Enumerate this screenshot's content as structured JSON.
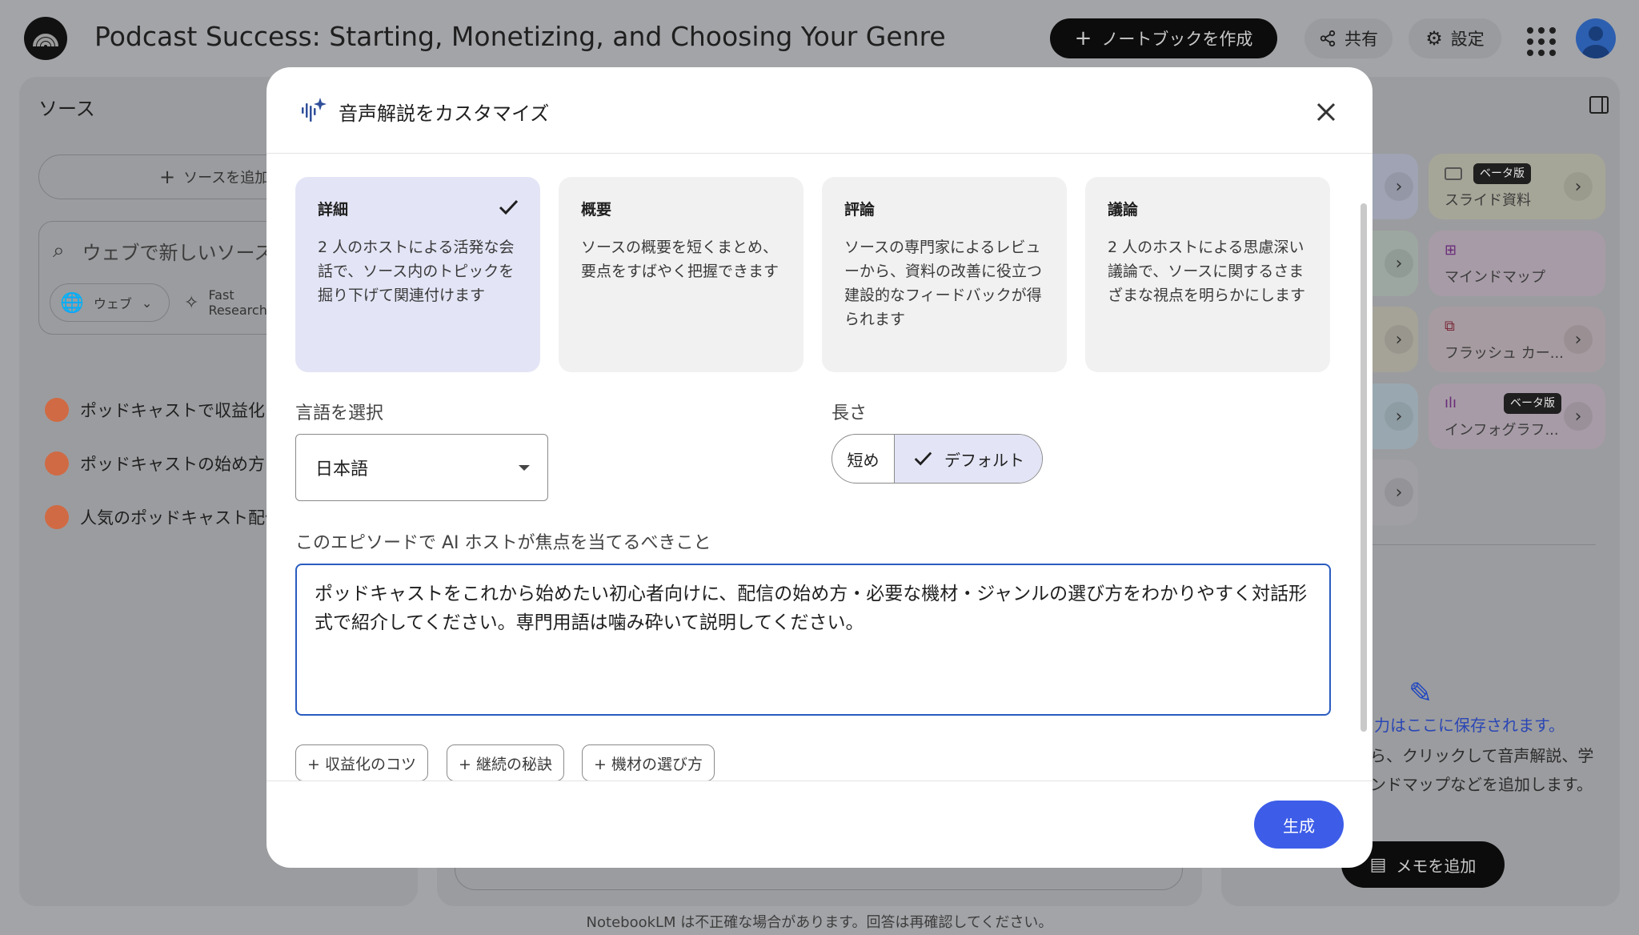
{
  "app": {
    "title": "Podcast Success: Starting, Monetizing, and Choosing Your Genre",
    "create_notebook_label": "ノートブックを作成",
    "share_label": "共有",
    "settings_label": "設定"
  },
  "sources_panel": {
    "title": "ソース",
    "add_source_label": "ソースを追加",
    "web_search_placeholder": "ウェブで新しいソース",
    "web_chip_label": "ウェブ",
    "fast_research_label": "Fast Research",
    "items": [
      {
        "label": "ポッドキャストで収益化する"
      },
      {
        "label": "ポッドキャストの始め方"
      },
      {
        "label": "人気のポッドキャスト配信"
      }
    ]
  },
  "studio_panel": {
    "cards": [
      {
        "label": "スライド資料",
        "badge": "ベータ版"
      },
      {
        "label": "マインドマップ"
      },
      {
        "label": "フラッシュ カー..."
      },
      {
        "label": "インフォグラフ...",
        "badge": "ベータ版"
      }
    ],
    "saved_title": "力はここに保存されます。",
    "saved_desc": "ら、クリックして音声解説、学 ンドマップなどを追加します。",
    "add_memo_label": "メモを追加"
  },
  "footer_note": "NotebookLM は不正確な場合があります。回答は再確認してください。",
  "modal": {
    "title": "音声解説をカスタマイズ",
    "formats": [
      {
        "title": "詳細",
        "desc": "2 人のホストによる活発な会話で、ソース内のトピックを掘り下げて関連付けます",
        "selected": true
      },
      {
        "title": "概要",
        "desc": "ソースの概要を短くまとめ、要点をすばやく把握できます",
        "selected": false
      },
      {
        "title": "評論",
        "desc": "ソースの専門家によるレビューから、資料の改善に役立つ建設的なフィードバックが得られます",
        "selected": false
      },
      {
        "title": "議論",
        "desc": "2 人のホストによる思慮深い議論で、ソースに関するさまざまな視点を明らかにします",
        "selected": false
      }
    ],
    "language_label": "言語を選択",
    "language_value": "日本語",
    "length_label": "長さ",
    "length_options": {
      "short": "短め",
      "default": "デフォルト"
    },
    "length_selected": "デフォルト",
    "focus_label": "このエピソードで AI ホストが焦点を当てるべきこと",
    "focus_value": "ポッドキャストをこれから始めたい初心者向けに、配信の始め方・必要な機材・ジャンルの選び方をわかりやすく対話形式で紹介してください。専門用語は噛み砕いて説明してください。",
    "suggestions": [
      "+ 収益化のコツ",
      "+ 継続の秘訣",
      "+ 機材の選び方"
    ],
    "generate_label": "生成"
  },
  "colors": {
    "accent": "#3d5de8",
    "selected_card": "#e3e5f6",
    "focus_border": "#2a5cc0",
    "overlay": "#a3a4a8"
  },
  "icons": [
    "podcast-logo-icon",
    "plus-icon",
    "share-icon",
    "gear-icon",
    "apps-grid-icon",
    "avatar",
    "search-icon",
    "globe-icon",
    "research-icon",
    "chevron-right-icon",
    "audio-sparkle-icon",
    "close-icon",
    "check-icon",
    "dropdown-arrow-icon",
    "magic-wand-icon",
    "note-icon"
  ]
}
